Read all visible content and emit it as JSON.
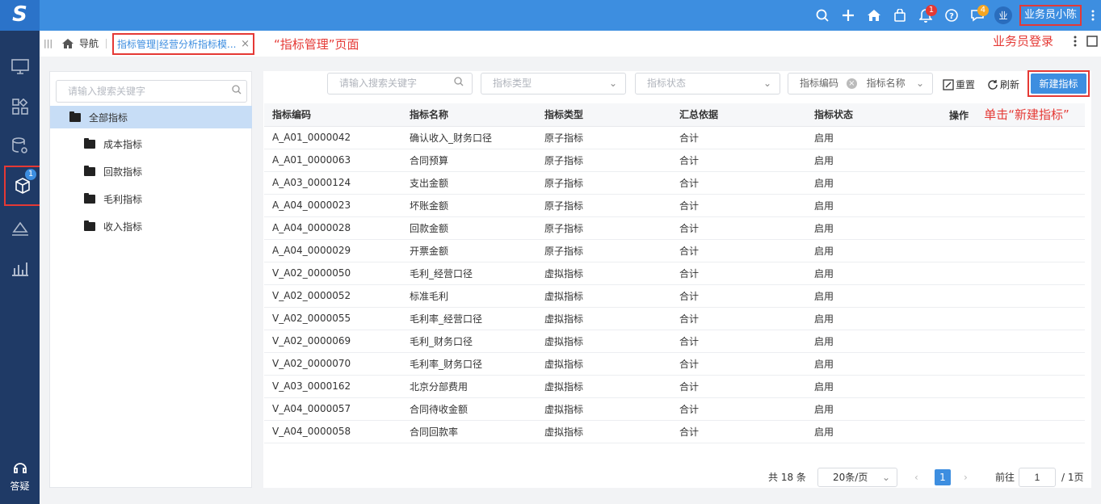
{
  "header": {
    "logo": "S",
    "badge_notify": "1",
    "badge_msg": "4",
    "avatar": "业",
    "user": "业务员小陈"
  },
  "tabs": {
    "nav_label": "导航",
    "current_tab": "指标管理|经营分析指标模...",
    "close": "×"
  },
  "annotations": {
    "page": "“指标管理”页面",
    "login": "业务员登录",
    "click_new": "单击“新建指标”"
  },
  "left_nav": {
    "badge": "1",
    "help": "答疑"
  },
  "tree": {
    "search_placeholder": "请输入搜索关键字",
    "root": "全部指标",
    "items": [
      "成本指标",
      "回款指标",
      "毛利指标",
      "收入指标"
    ]
  },
  "toolbar": {
    "search_placeholder": "请输入搜索关键字",
    "type_placeholder": "指标类型",
    "status_placeholder": "指标状态",
    "code_tag": "指标编码",
    "name_tag": "指标名称",
    "reset": "重置",
    "refresh": "刷新",
    "new": "新建指标"
  },
  "table": {
    "headers": [
      "指标编码",
      "指标名称",
      "指标类型",
      "汇总依据",
      "指标状态",
      "操作"
    ],
    "rows": [
      [
        "A_A01_0000042",
        "确认收入_财务口径",
        "原子指标",
        "合计",
        "启用"
      ],
      [
        "A_A01_0000063",
        "合同预算",
        "原子指标",
        "合计",
        "启用"
      ],
      [
        "A_A03_0000124",
        "支出金额",
        "原子指标",
        "合计",
        "启用"
      ],
      [
        "A_A04_0000023",
        "坏账金额",
        "原子指标",
        "合计",
        "启用"
      ],
      [
        "A_A04_0000028",
        "回款金额",
        "原子指标",
        "合计",
        "启用"
      ],
      [
        "A_A04_0000029",
        "开票金额",
        "原子指标",
        "合计",
        "启用"
      ],
      [
        "V_A02_0000050",
        "毛利_经营口径",
        "虚拟指标",
        "合计",
        "启用"
      ],
      [
        "V_A02_0000052",
        "标准毛利",
        "虚拟指标",
        "合计",
        "启用"
      ],
      [
        "V_A02_0000055",
        "毛利率_经营口径",
        "虚拟指标",
        "合计",
        "启用"
      ],
      [
        "V_A02_0000069",
        "毛利_财务口径",
        "虚拟指标",
        "合计",
        "启用"
      ],
      [
        "V_A02_0000070",
        "毛利率_财务口径",
        "虚拟指标",
        "合计",
        "启用"
      ],
      [
        "V_A03_0000162",
        "北京分部费用",
        "虚拟指标",
        "合计",
        "启用"
      ],
      [
        "V_A04_0000057",
        "合同待收金额",
        "虚拟指标",
        "合计",
        "启用"
      ],
      [
        "V_A04_0000058",
        "合同回款率",
        "虚拟指标",
        "合计",
        "启用"
      ]
    ]
  },
  "pager": {
    "total": "共 18 条",
    "page_size": "20条/页",
    "current": "1",
    "goto": "前往",
    "goto_value": "1",
    "pages": "/ 1页"
  }
}
